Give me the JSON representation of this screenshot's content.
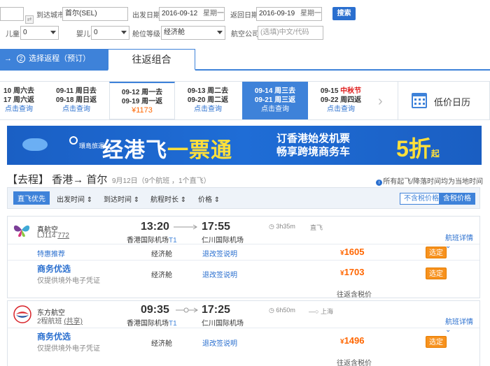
{
  "search": {
    "to_city_label": "到达城市",
    "to_city_value": "首尔(SEL)",
    "depart_label": "出发日期",
    "depart_value": "2016-09-12",
    "depart_week": "星期一",
    "return_label": "返回日期",
    "return_value": "2016-09-19",
    "return_week": "星期一",
    "search_button": "搜索",
    "child_label": "儿童",
    "child_value": "0",
    "infant_label": "婴儿",
    "infant_value": "0",
    "cabin_label": "舱位等级",
    "cabin_value": "经济舱",
    "airline_label": "航空公司",
    "airline_placeholder": "(选填)中文/代码"
  },
  "steps": {
    "step1_text": "选择返程（预订）",
    "step1_num": "2",
    "step1_arrow": "→",
    "step2_text": "往返组合"
  },
  "dates": [
    {
      "line1": "10 周六去",
      "line2": "17 周六返",
      "link": "点击查询"
    },
    {
      "line1": "09-11 周日去",
      "line2": "09-18 周日返",
      "link": "点击查询"
    },
    {
      "line1": "09-12 周一去",
      "line2": "09-19 周一返",
      "price": "¥1173"
    },
    {
      "line1": "09-13 周二去",
      "line2": "09-20 周二返",
      "link": "点击查询"
    },
    {
      "line1": "09-14 周三去",
      "line2": "09-21 周三返",
      "link": "点击查询"
    },
    {
      "line1a": "09-15 ",
      "line1b": "中秋节",
      "line2": "09-22 周四返",
      "link": "点击查询"
    }
  ],
  "calendar_label": "低价日历",
  "banner": {
    "logo_text": "環島旅運",
    "headline_a": "经港飞",
    "headline_b": "一票通",
    "sub1": "订香港始发机票",
    "sub2": "畅享跨境商务车",
    "discount": "5折",
    "discount_suffix": "起"
  },
  "route": {
    "title": "【去程】 香港→ 首尔",
    "sub": "9月12日（9个航班 ，1个直飞）",
    "note": "所有起飞/降落时间均为当地时间"
  },
  "sort": {
    "direct": "直飞优先",
    "depart": "出发时间 ⇕",
    "arrive": "到达时间 ⇕",
    "duration": "航程时长 ⇕",
    "price": "价格 ⇕",
    "no_tax": "不含税价格",
    "with_tax": "含税价格"
  },
  "flights": [
    {
      "airline": "真航空",
      "flight_no": "LJ114",
      "aircraft": "772",
      "dep_time": "13:20",
      "arr_time": "17:55",
      "dep_airport": "香港国际机场",
      "dep_terminal": "T1",
      "arr_airport": "仁川国际机场",
      "duration": "3h35m",
      "stop": "直飞",
      "detail": "航班详情 ⌄",
      "fares": [
        {
          "tag": "特惠推荐",
          "cabin": "经济舱",
          "rule": "退改签说明",
          "price": "1605",
          "book": "选定"
        },
        {
          "biz": "商务优选",
          "biz_sub": "仅提供境外电子凭证",
          "cabin": "经济舱",
          "rule": "退改签说明",
          "price": "1703",
          "book": "选定"
        }
      ],
      "retax": "往返含税价"
    },
    {
      "airline": "东方航空",
      "flight_no": "2程航班",
      "aircraft": "(共享)",
      "dep_time": "09:35",
      "arr_time": "17:25",
      "dep_airport": "香港国际机场",
      "dep_terminal": "T1",
      "arr_airport": "仁川国际机场",
      "duration": "6h50m",
      "stop": "上海",
      "detail": "航班详情 ⌄",
      "fares": [
        {
          "biz": "商务优选",
          "biz_sub": "仅提供境外电子凭证",
          "cabin": "经济舱",
          "rule": "退改签说明",
          "price": "1496",
          "book": "选定"
        }
      ],
      "retax": "往返含税价"
    }
  ],
  "currency": "¥",
  "colors": {
    "accent": "#3e82d9",
    "price": "#ff6600",
    "book": "#f7921e"
  }
}
